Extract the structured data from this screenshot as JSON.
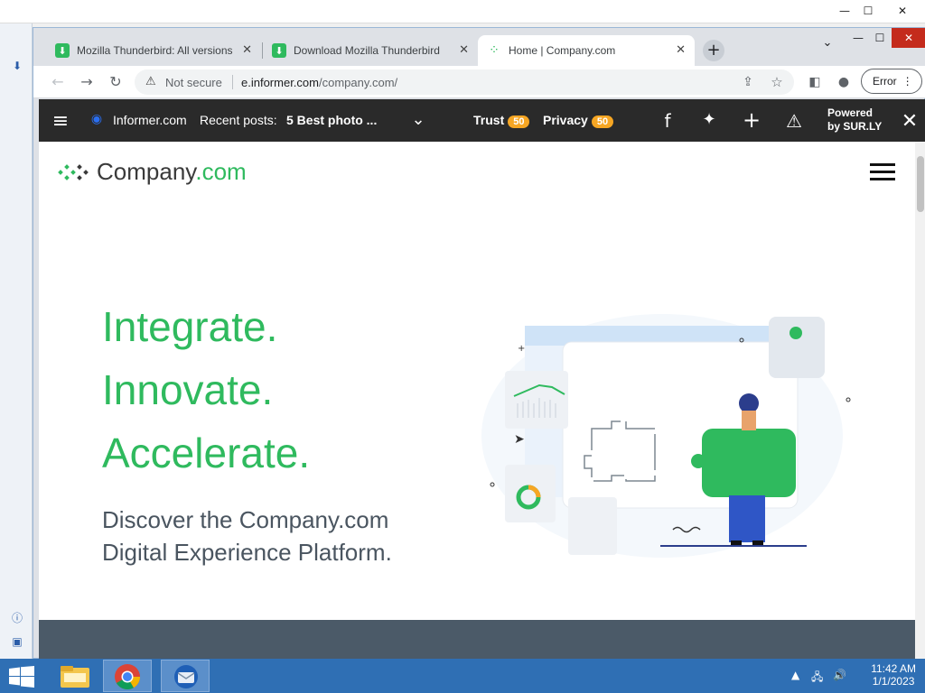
{
  "browser": {
    "tabs": [
      {
        "title": "Mozilla Thunderbird: All versions",
        "icon": "download-icon",
        "color": "#2fba5e"
      },
      {
        "title": "Download Mozilla Thunderbird",
        "icon": "download-icon",
        "color": "#2fba5e"
      },
      {
        "title": "Home | Company.com",
        "icon": "company-logo-icon",
        "color": "#2fba5e"
      }
    ],
    "omnibox": {
      "security_label": "Not secure",
      "url_host": "e.informer.com",
      "url_path": "/company.com/"
    },
    "error_label": "Error"
  },
  "informer": {
    "site_label": "Informer.com",
    "recent_prefix": "Recent posts:",
    "recent_post": "5 Best photo ...",
    "trust_label": "Trust",
    "trust_score": "50",
    "privacy_label": "Privacy",
    "privacy_score": "50",
    "powered_line1": "Powered",
    "powered_line2": "by SUR.LY"
  },
  "page": {
    "logo_main": "Company",
    "logo_suffix": ".com",
    "headlines": [
      "Integrate.",
      "Innovate.",
      "Accelerate."
    ],
    "sublines": [
      "Discover the Company.com",
      "Digital Experience Platform."
    ]
  },
  "taskbar": {
    "time": "11:42 AM",
    "date": "1/1/2023"
  },
  "colors": {
    "accent": "#2fba5e",
    "badge": "#f6a623",
    "informer_bg": "#2a2a2a",
    "taskbar": "#2f6fb4"
  }
}
